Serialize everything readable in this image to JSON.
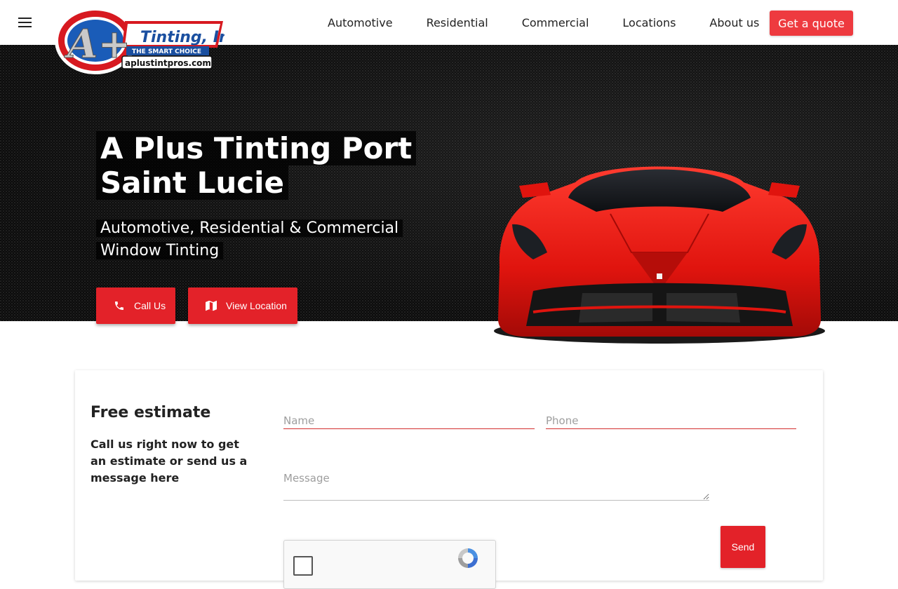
{
  "header": {
    "menu_icon": "hamburger-menu-icon",
    "logo": {
      "brand": "Tinting, Inc.",
      "tagline": "THE SMART CHOICE",
      "website": "aplustintpros.com",
      "monogram": "A+"
    },
    "nav": [
      {
        "label": "Automotive"
      },
      {
        "label": "Residential"
      },
      {
        "label": "Commercial"
      },
      {
        "label": "Locations"
      },
      {
        "label": "About us"
      }
    ],
    "quote_label": "Get a quote"
  },
  "hero": {
    "title": "A Plus Tinting Port Saint Lucie",
    "subtitle": "Automotive, Residential & Commercial Window Tinting",
    "call_label": "Call Us",
    "call_icon": "phone-icon",
    "location_label": "View Location",
    "location_icon": "map-icon",
    "image": "red-sports-car"
  },
  "estimate": {
    "title": "Free estimate",
    "description": "Call us right now to get an estimate or send us a message here",
    "name_placeholder": "Name",
    "phone_placeholder": "Phone",
    "message_placeholder": "Message",
    "send_label": "Send",
    "captcha_icon": "recaptcha-icon"
  },
  "colors": {
    "accent_red": "#e32229",
    "quote_red": "#ee3a3f",
    "hero_bg": "#0b0b0b"
  }
}
